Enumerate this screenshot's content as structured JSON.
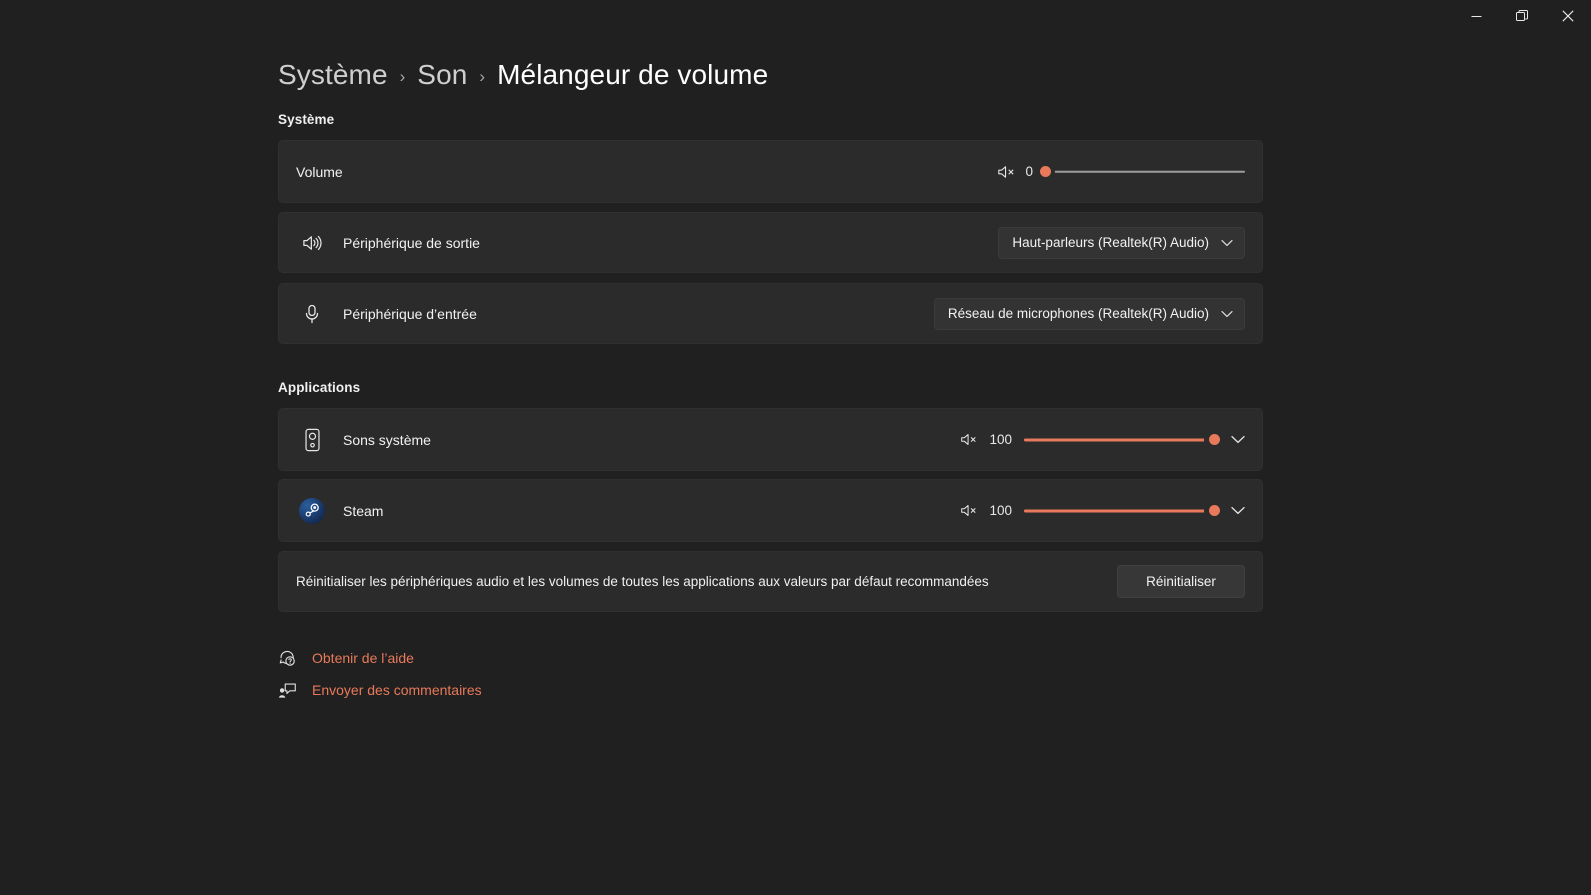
{
  "window": {
    "controls": [
      {
        "name": "minimize",
        "glyph": "minimize-icon",
        "tooltip": "Réduire"
      },
      {
        "name": "maximize",
        "glyph": "restore-icon",
        "tooltip": "Agrandir"
      },
      {
        "name": "close",
        "glyph": "close-icon",
        "tooltip": "Fermer"
      }
    ]
  },
  "breadcrumb": {
    "items": [
      "Système",
      "Son",
      "Mélangeur de volume"
    ],
    "separator": "›"
  },
  "sections": {
    "system": {
      "label": "Système",
      "rows": {
        "volume": {
          "title": "Volume",
          "icon": "speaker-muted-icon",
          "value": "0",
          "percent": 0
        },
        "output": {
          "title": "Périphérique de sortie",
          "icon": "speaker-waves-icon",
          "dropdown_value": "Haut-parleurs (Realtek(R) Audio)",
          "dropdown_chevron": "chevron-down-icon"
        },
        "input": {
          "title": "Périphérique d’entrée",
          "icon": "microphone-icon",
          "dropdown_value": "Réseau de microphones (Realtek(R) Audio)",
          "dropdown_chevron": "chevron-down-icon"
        }
      }
    },
    "applications": {
      "label": "Applications",
      "rows": [
        {
          "title": "Sons système",
          "icon": "system-speaker-icon",
          "mute_icon": "speaker-muted-icon",
          "value": "100",
          "percent": 100,
          "expand_icon": "chevron-down-icon"
        },
        {
          "title": "Steam",
          "icon": "steam-logo-icon",
          "mute_icon": "speaker-muted-icon",
          "value": "100",
          "percent": 100,
          "expand_icon": "chevron-down-icon"
        }
      ]
    },
    "reset": {
      "description": "Réinitialiser les périphériques audio et les volumes de toutes les applications aux valeurs par défaut recommandées",
      "button_label": "Réinitialiser"
    }
  },
  "footer": {
    "links": [
      {
        "label": "Obtenir de l’aide",
        "icon": "help-icon"
      },
      {
        "label": "Envoyer des commentaires",
        "icon": "feedback-icon"
      }
    ]
  },
  "colors": {
    "accent": "#e8795a",
    "page_background": "#202020",
    "card_background": "#2b2b2b",
    "text_primary": "#f2f2f2"
  }
}
